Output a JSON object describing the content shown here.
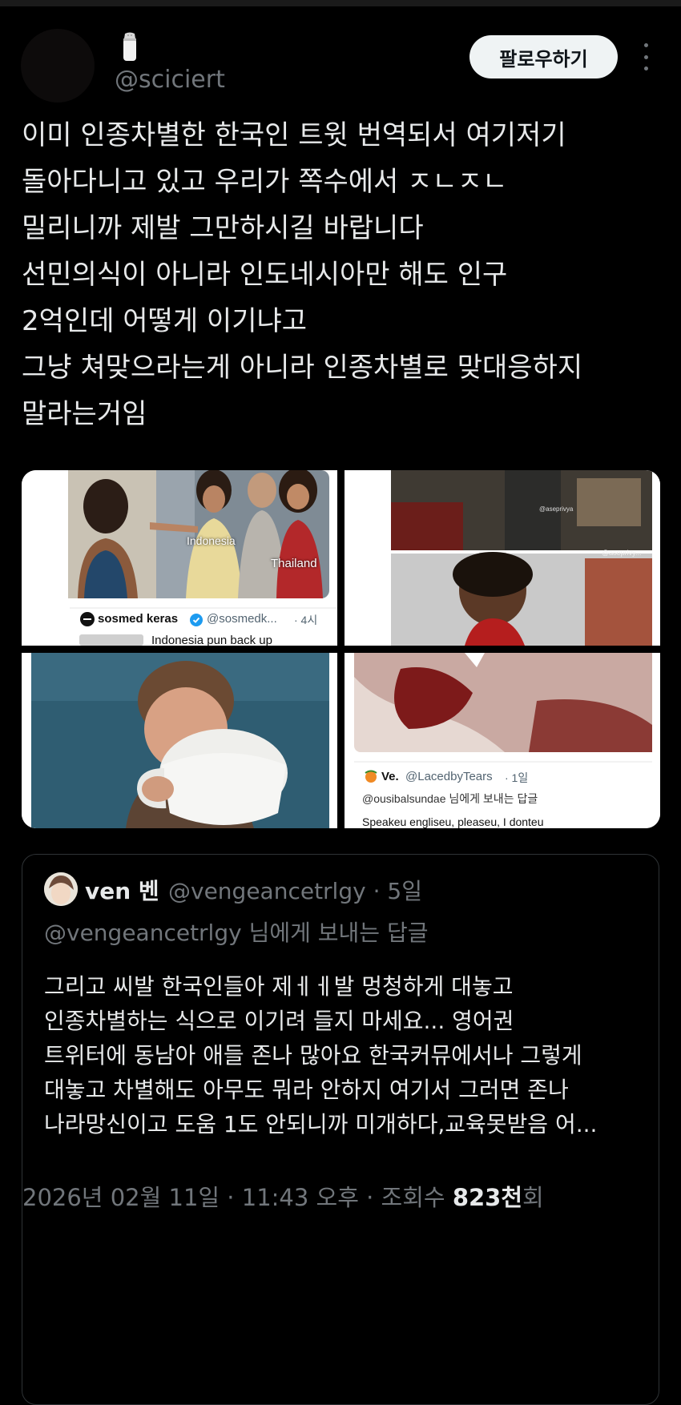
{
  "author": {
    "handle": "@sciciert",
    "emoji": "salt-shaker"
  },
  "follow_label": "팔로우하기",
  "tweet_lines": [
    "이미 인종차별한 한국인 트윗 번역되서 여기저기",
    "돌아다니고 있고 우리가 쪽수에서 ㅈㄴㅈㄴ",
    "밀리니까 제발 그만하시길 바랍니다",
    "선민의식이 아니라 인도네시아만 해도 인구",
    "2억인데 어떻게 이기냐고",
    "그냥 쳐맞으라는게 아니라 인종차별로 맞대응하지",
    "말라는거임"
  ],
  "media": {
    "tile1": {
      "label_a": "Indonesia",
      "label_b": "Thailand",
      "account_name": "sosmed keras",
      "account_handle": "@sosmedk...",
      "time": "· 4시",
      "snippet": "Indonesia pun back up"
    },
    "tile2": {
      "watermark_a": "@aseprivya",
      "watermark_b": "@aseprivy..."
    },
    "tile4": {
      "account_name": "Ve.",
      "account_handle": "@LacedbyTears",
      "time": "· 1일",
      "reply_to": "@ousibalsundae 님에게 보내는 답글",
      "snippet": "Speakeu engliseu, pleaseu, I donteu"
    }
  },
  "quote": {
    "name": "ven 벤",
    "handle_time": "@vengeancetrlgy · 5일",
    "reply_to": "@vengeancetrlgy 님에게 보내는 답글",
    "lines": [
      "그리고 씨발 한국인들아 제ㅔㅔ발 멍청하게 대놓고",
      "인종차별하는 식으로 이기려 들지 마세요... 영어권",
      "트위터에 동남아 애들 존나 많아요 한국커뮤에서나 그렇게",
      "대놓고 차별해도 아무도 뭐라 안하지 여기서 그러면 존나",
      "나라망신이고 도움 1도 안되니까 미개하다,교육못받음 어..."
    ]
  },
  "meta": {
    "date_time": "2026년 02월 11일 · 11:43 오후 · 조회수 ",
    "views": "823천",
    "views_suffix": "회"
  },
  "colors": {
    "background": "#000000",
    "text": "#e7e9ea",
    "muted": "#71767b",
    "follow_bg": "#eff3f4",
    "verified": "#1d9bf0"
  }
}
